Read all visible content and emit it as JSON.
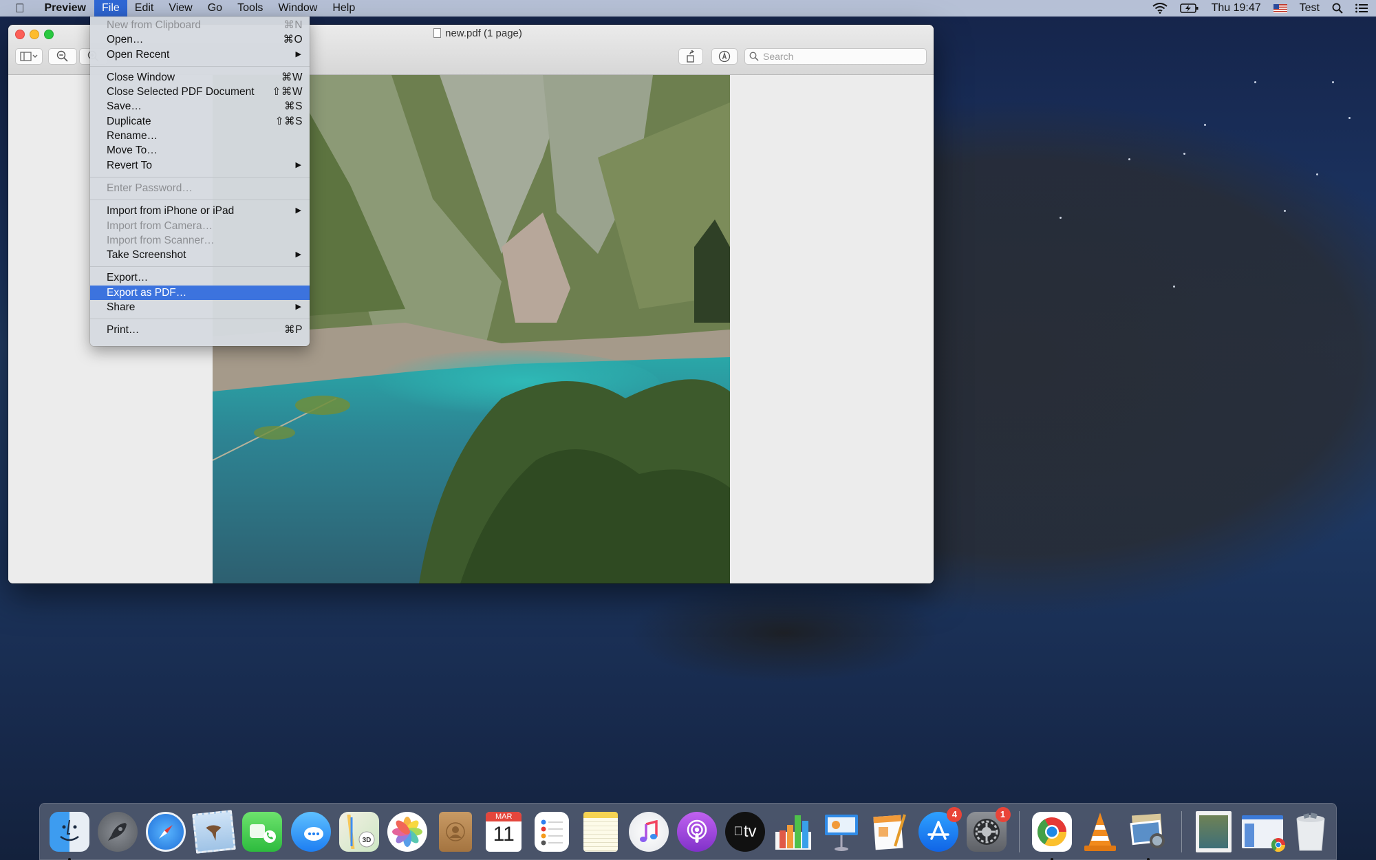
{
  "menubar": {
    "apple_icon": "apple-logo-icon",
    "app_name": "Preview",
    "menus": [
      "File",
      "Edit",
      "View",
      "Go",
      "Tools",
      "Window",
      "Help"
    ],
    "active_menu": "File",
    "status": {
      "wifi_icon": "wifi-icon",
      "battery_icon": "battery-charging-icon",
      "clock": "Thu 19:47",
      "input_source_icon": "us-flag-icon",
      "user": "Test",
      "spotlight_icon": "search-icon",
      "notification_icon": "list-icon"
    }
  },
  "window": {
    "title": "new.pdf (1 page)",
    "search_placeholder": "Search",
    "toolbar": {
      "sidebar_toggle": "sidebar-icon",
      "zoom_out": "zoom-out-icon",
      "zoom_in": "zoom-in-icon",
      "rotate": "rotate-icon",
      "markup": "markup-pen-icon"
    },
    "document_content": "Photo of a turquoise lake in a forested mountain canyon"
  },
  "file_menu": {
    "groups": [
      [
        {
          "label": "New from Clipboard",
          "shortcut": "⌘N",
          "disabled": true
        },
        {
          "label": "Open…",
          "shortcut": "⌘O"
        },
        {
          "label": "Open Recent",
          "submenu": true
        }
      ],
      [
        {
          "label": "Close Window",
          "shortcut": "⌘W"
        },
        {
          "label": "Close Selected PDF Document",
          "shortcut": "⇧⌘W"
        },
        {
          "label": "Save…",
          "shortcut": "⌘S"
        },
        {
          "label": "Duplicate",
          "shortcut": "⇧⌘S"
        },
        {
          "label": "Rename…"
        },
        {
          "label": "Move To…"
        },
        {
          "label": "Revert To",
          "submenu": true
        }
      ],
      [
        {
          "label": "Enter Password…",
          "disabled": true
        }
      ],
      [
        {
          "label": "Import from iPhone or iPad",
          "submenu": true
        },
        {
          "label": "Import from Camera…",
          "disabled": true
        },
        {
          "label": "Import from Scanner…",
          "disabled": true
        },
        {
          "label": "Take Screenshot",
          "submenu": true
        }
      ],
      [
        {
          "label": "Export…"
        },
        {
          "label": "Export as PDF…",
          "highlighted": true
        },
        {
          "label": "Share",
          "submenu": true
        }
      ],
      [
        {
          "label": "Print…",
          "shortcut": "⌘P"
        }
      ]
    ],
    "submenu_arrow": "▶"
  },
  "dock": {
    "apps": [
      {
        "name": "Finder",
        "icon": "finder-icon",
        "running": true
      },
      {
        "name": "Launchpad",
        "icon": "launchpad-icon"
      },
      {
        "name": "Safari",
        "icon": "safari-icon"
      },
      {
        "name": "Mail",
        "icon": "mail-icon"
      },
      {
        "name": "FaceTime",
        "icon": "facetime-icon"
      },
      {
        "name": "Messages",
        "icon": "messages-icon"
      },
      {
        "name": "Maps",
        "icon": "maps-icon"
      },
      {
        "name": "Photos",
        "icon": "photos-icon"
      },
      {
        "name": "Contacts",
        "icon": "contacts-icon"
      },
      {
        "name": "Calendar",
        "icon": "calendar-icon",
        "month": "MAR",
        "day": "11"
      },
      {
        "name": "Reminders",
        "icon": "reminders-icon"
      },
      {
        "name": "Notes",
        "icon": "notes-icon"
      },
      {
        "name": "Music",
        "icon": "music-icon"
      },
      {
        "name": "Podcasts",
        "icon": "podcasts-icon"
      },
      {
        "name": "TV",
        "icon": "apple-tv-icon",
        "text": "tv"
      },
      {
        "name": "Numbers",
        "icon": "numbers-icon"
      },
      {
        "name": "Keynote",
        "icon": "keynote-icon"
      },
      {
        "name": "Pages",
        "icon": "pages-icon"
      },
      {
        "name": "App Store",
        "icon": "app-store-icon",
        "badge": "4"
      },
      {
        "name": "System Preferences",
        "icon": "system-preferences-icon",
        "badge": "1"
      }
    ],
    "recent_apps": [
      {
        "name": "Google Chrome",
        "icon": "chrome-icon",
        "running": true
      },
      {
        "name": "VLC",
        "icon": "vlc-icon"
      },
      {
        "name": "Preview",
        "icon": "preview-icon",
        "running": true
      }
    ],
    "stacks": [
      {
        "name": "new.pdf",
        "icon": "pdf-document-icon"
      },
      {
        "name": "Chrome window",
        "icon": "minimized-window-icon"
      },
      {
        "name": "Trash",
        "icon": "trash-icon"
      }
    ]
  }
}
